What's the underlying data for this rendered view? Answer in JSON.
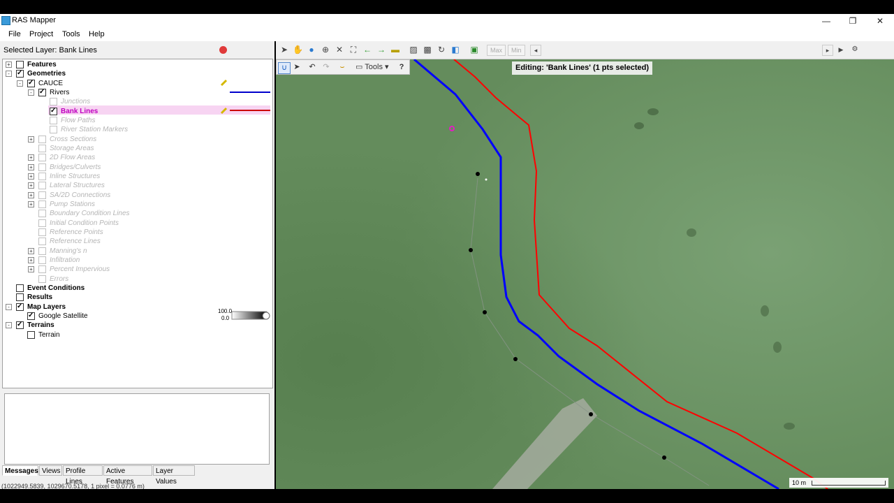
{
  "window": {
    "title": "RAS Mapper",
    "controls": [
      "—",
      "❐",
      "✕"
    ]
  },
  "menu": [
    "File",
    "Project",
    "Tools",
    "Help"
  ],
  "selected_layer": "Selected Layer: Bank Lines",
  "tree": [
    {
      "label": "Features",
      "bold": true,
      "checked": false,
      "exp": "+"
    },
    {
      "label": "Geometries",
      "bold": true,
      "checked": true,
      "exp": "−"
    },
    {
      "label": "CAUCE",
      "checked": true,
      "exp": "−"
    },
    {
      "label": "Rivers",
      "checked": true,
      "exp": "−"
    },
    {
      "label": "Junctions",
      "disabled": true
    },
    {
      "label": "Bank Lines",
      "checked": true,
      "selected": true
    },
    {
      "label": "Flow Paths",
      "disabled": true
    },
    {
      "label": "River Station Markers",
      "disabled": true
    },
    {
      "label": "Cross Sections",
      "disabled": true,
      "exp": "+"
    },
    {
      "label": "Storage Areas",
      "disabled": true
    },
    {
      "label": "2D Flow Areas",
      "disabled": true,
      "exp": "+"
    },
    {
      "label": "Bridges/Culverts",
      "disabled": true,
      "exp": "+"
    },
    {
      "label": "Inline Structures",
      "disabled": true,
      "exp": "+"
    },
    {
      "label": "Lateral Structures",
      "disabled": true,
      "exp": "+"
    },
    {
      "label": "SA/2D Connections",
      "disabled": true,
      "exp": "+"
    },
    {
      "label": "Pump Stations",
      "disabled": true,
      "exp": "+"
    },
    {
      "label": "Boundary Condition Lines",
      "disabled": true
    },
    {
      "label": "Initial Condition Points",
      "disabled": true
    },
    {
      "label": "Reference Points",
      "disabled": true
    },
    {
      "label": "Reference Lines",
      "disabled": true
    },
    {
      "label": "Manning's n",
      "disabled": true,
      "exp": "+"
    },
    {
      "label": "Infiltration",
      "disabled": true,
      "exp": "+"
    },
    {
      "label": "Percent Impervious",
      "disabled": true,
      "exp": "+"
    },
    {
      "label": "Errors",
      "disabled": true
    },
    {
      "label": "Event Conditions",
      "bold": true,
      "checked": false
    },
    {
      "label": "Results",
      "bold": true,
      "checked": false
    },
    {
      "label": "Map Layers",
      "bold": true,
      "checked": true,
      "exp": "−"
    },
    {
      "label": "Google Satellite",
      "checked": true
    },
    {
      "label": "Terrains",
      "bold": true,
      "checked": true,
      "exp": "−"
    },
    {
      "label": "Terrain",
      "checked": false
    }
  ],
  "legend": {
    "opacity_top": "100.0",
    "opacity_bottom": "0.0"
  },
  "tabs": [
    "Messages",
    "Views",
    "Profile Lines",
    "Active Features",
    "Layer Values"
  ],
  "status_text": "(1022949.5839, 1029670.5178, 1 pixel = 0.0776 m)",
  "toolbar": {
    "max_label": "Max",
    "min_label": "Min"
  },
  "map_toolbar": {
    "tools_label": "Tools",
    "help_label": "?"
  },
  "editing_label": "Editing: 'Bank Lines' (1 pts selected)",
  "scale_label": "10 m",
  "colors": {
    "river": "#0000ff",
    "bank_line": "#ff0000",
    "selection": "#f7d4f2"
  }
}
